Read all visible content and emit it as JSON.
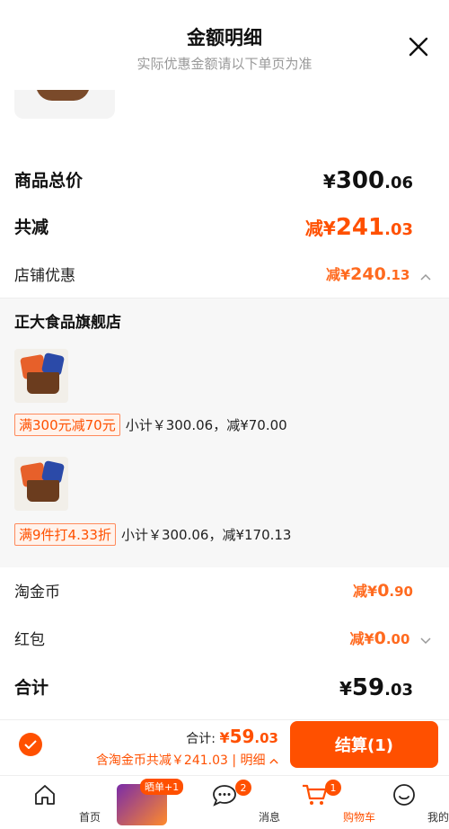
{
  "header": {
    "title": "金额明细",
    "subtitle": "实际优惠金额请以下单页为准"
  },
  "summary": {
    "goods_total_label": "商品总价",
    "goods_total": {
      "cur": "¥",
      "int": "300",
      "dec": ".06"
    },
    "reduce_label": "共减",
    "reduce_total": {
      "prefix": "减¥",
      "int": "241",
      "dec": ".03"
    },
    "store_discount_label": "店铺优惠",
    "store_discount": {
      "prefix": "减¥",
      "int": "240",
      "dec": ".13"
    }
  },
  "store": {
    "name": "正大食品旗舰店",
    "promos": [
      {
        "tag": "满300元减70元",
        "detail": "小计￥300.06，减¥70.00"
      },
      {
        "tag": "满9件打4.33折",
        "detail": "小计￥300.06，减¥170.13"
      }
    ]
  },
  "extras": {
    "coin_label": "淘金币",
    "coin": {
      "prefix": "减¥",
      "int": "0",
      "dec": ".90"
    },
    "redpacket_label": "红包",
    "redpacket": {
      "prefix": "减¥",
      "int": "0",
      "dec": ".00"
    }
  },
  "total": {
    "label": "合计",
    "value": {
      "cur": "¥",
      "int": "59",
      "dec": ".03"
    }
  },
  "footer": {
    "total_prefix": "合计:",
    "total": {
      "cur": "¥",
      "int": "59",
      "dec": ".03"
    },
    "subline": "含淘金币共减￥241.03 | 明细",
    "checkout": "结算(1)"
  },
  "tabbar": {
    "home": "首页",
    "promo_badge": "晒单+1",
    "messages": "消息",
    "messages_badge": "2",
    "cart": "购物车",
    "cart_badge": "1",
    "mine": "我的淘宝"
  },
  "colors": {
    "accent": "#ff5000"
  }
}
